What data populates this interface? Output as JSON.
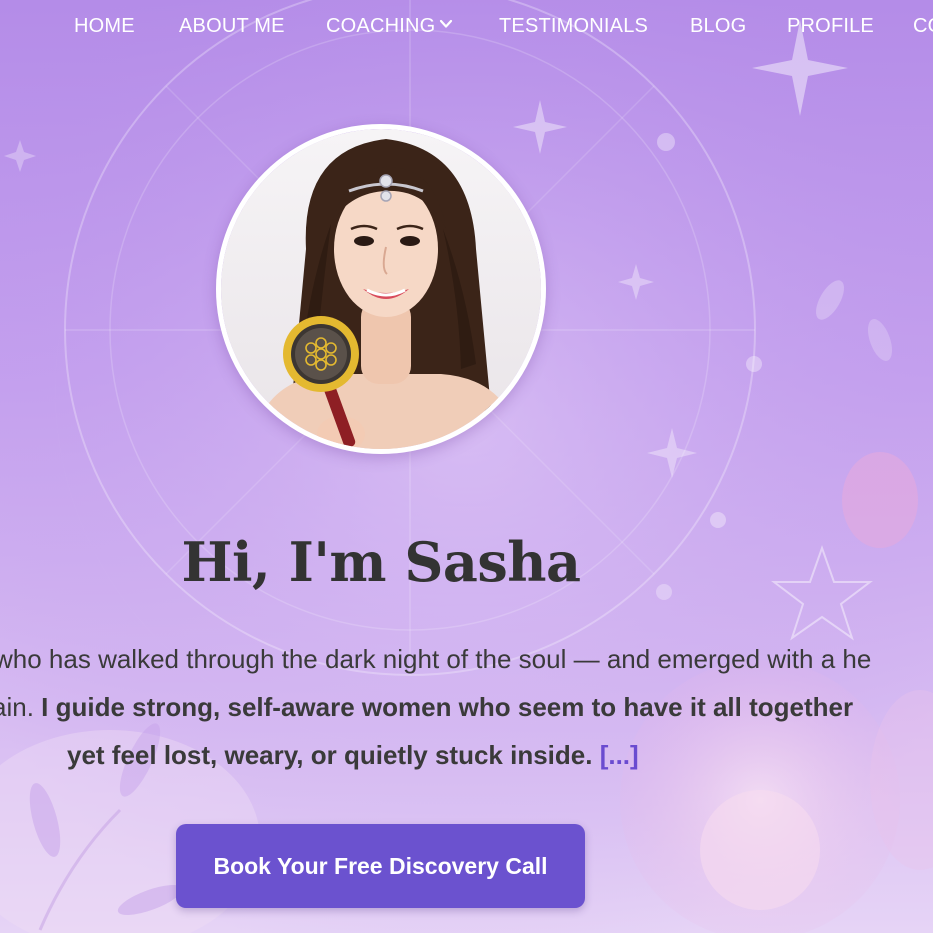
{
  "nav": {
    "items": [
      {
        "label": "HOME"
      },
      {
        "label": "ABOUT ME"
      },
      {
        "label": "COACHING"
      },
      {
        "label": "TESTIMONIALS"
      },
      {
        "label": "BLOG"
      },
      {
        "label": "PROFILE"
      },
      {
        "label": "CO"
      }
    ],
    "dropdown_icon": "chevron-down-icon"
  },
  "hero": {
    "heading": "Hi, I'm Sasha",
    "intro_line1": "who has walked through the dark night of the soul — and emerged with a he",
    "intro_line2_plain": "ain. ",
    "intro_line2_bold": "I guide strong, self-aware women who seem to have it all together",
    "intro_line3_bold": "yet feel lost, weary, or quietly stuck inside. ",
    "read_more": "[...]",
    "cta_label": "Book Your Free Discovery Call"
  },
  "colors": {
    "accent": "#6b52cf",
    "background_top": "#b48ce8",
    "background_bottom": "#e6d4f6",
    "text": "#333333",
    "nav_text": "#ffffff"
  }
}
